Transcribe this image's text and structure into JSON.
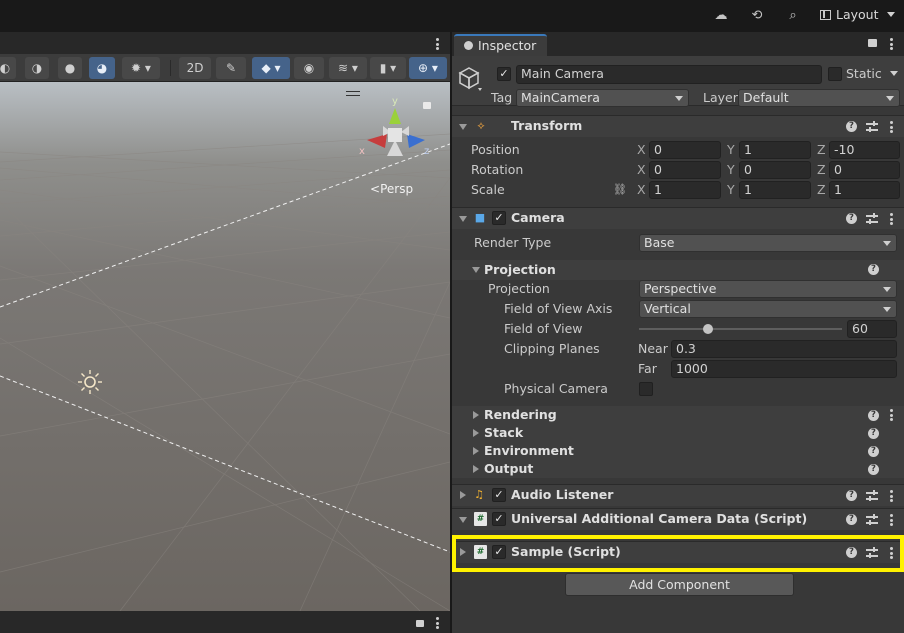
{
  "topbar": {
    "layout_label": "Layout",
    "icons": [
      "cloud-icon",
      "history-icon",
      "search-icon",
      "layout-icon"
    ]
  },
  "scene": {
    "orientation_label": "Persp",
    "gizmo_y": "y",
    "gizmo_x": "x",
    "gizmo_z": "z"
  },
  "inspector": {
    "tab_label": "Inspector",
    "object": {
      "name": "Main Camera",
      "static_label": "Static",
      "tag_label": "Tag",
      "tag_value": "MainCamera",
      "layer_label": "Layer",
      "layer_value": "Default"
    },
    "transform": {
      "title": "Transform",
      "position_label": "Position",
      "rotation_label": "Rotation",
      "scale_label": "Scale",
      "axis_x": "X",
      "axis_y": "Y",
      "axis_z": "Z",
      "position": [
        "0",
        "1",
        "-10"
      ],
      "rotation": [
        "0",
        "0",
        "0"
      ],
      "scale": [
        "1",
        "1",
        "1"
      ]
    },
    "camera": {
      "title": "Camera",
      "render_type_label": "Render Type",
      "render_type_value": "Base",
      "projection_section": "Projection",
      "projection_label": "Projection",
      "projection_value": "Perspective",
      "fov_axis_label": "Field of View Axis",
      "fov_axis_value": "Vertical",
      "fov_label": "Field of View",
      "fov_value": "60",
      "fov_slider_fraction": 0.34,
      "clipping_label": "Clipping Planes",
      "near_label": "Near",
      "near_value": "0.3",
      "far_label": "Far",
      "far_value": "1000",
      "physical_camera_label": "Physical Camera",
      "sections": [
        "Rendering",
        "Stack",
        "Environment",
        "Output"
      ]
    },
    "audio_listener": {
      "title": "Audio Listener"
    },
    "ua_camera_data": {
      "title": "Universal Additional Camera Data (Script)"
    },
    "sample_script": {
      "title": "Sample (Script)"
    },
    "add_component_label": "Add Component"
  },
  "colors": {
    "highlight": "#fff200",
    "active_tab_accent": "#3a79bb",
    "active_toggle": "#45638a"
  }
}
